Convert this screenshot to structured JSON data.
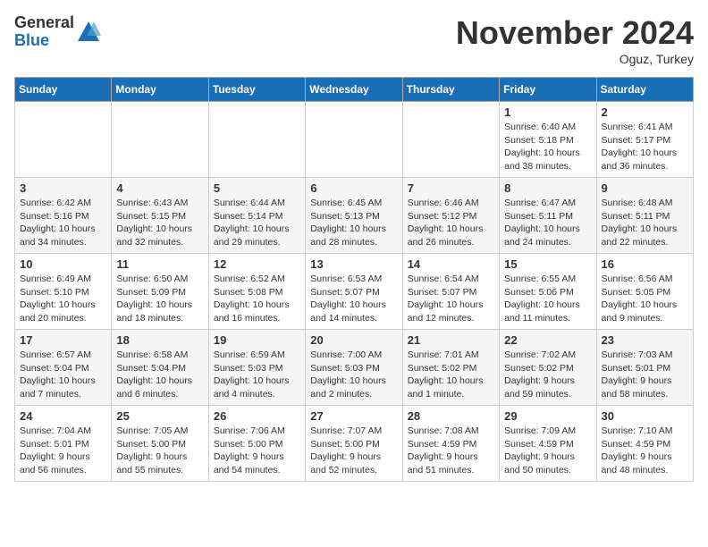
{
  "header": {
    "logo_general": "General",
    "logo_blue": "Blue",
    "month_title": "November 2024",
    "location": "Oguz, Turkey"
  },
  "weekdays": [
    "Sunday",
    "Monday",
    "Tuesday",
    "Wednesday",
    "Thursday",
    "Friday",
    "Saturday"
  ],
  "rows": [
    [
      {
        "day": "",
        "info": ""
      },
      {
        "day": "",
        "info": ""
      },
      {
        "day": "",
        "info": ""
      },
      {
        "day": "",
        "info": ""
      },
      {
        "day": "",
        "info": ""
      },
      {
        "day": "1",
        "info": "Sunrise: 6:40 AM\nSunset: 5:18 PM\nDaylight: 10 hours\nand 38 minutes."
      },
      {
        "day": "2",
        "info": "Sunrise: 6:41 AM\nSunset: 5:17 PM\nDaylight: 10 hours\nand 36 minutes."
      }
    ],
    [
      {
        "day": "3",
        "info": "Sunrise: 6:42 AM\nSunset: 5:16 PM\nDaylight: 10 hours\nand 34 minutes."
      },
      {
        "day": "4",
        "info": "Sunrise: 6:43 AM\nSunset: 5:15 PM\nDaylight: 10 hours\nand 32 minutes."
      },
      {
        "day": "5",
        "info": "Sunrise: 6:44 AM\nSunset: 5:14 PM\nDaylight: 10 hours\nand 29 minutes."
      },
      {
        "day": "6",
        "info": "Sunrise: 6:45 AM\nSunset: 5:13 PM\nDaylight: 10 hours\nand 28 minutes."
      },
      {
        "day": "7",
        "info": "Sunrise: 6:46 AM\nSunset: 5:12 PM\nDaylight: 10 hours\nand 26 minutes."
      },
      {
        "day": "8",
        "info": "Sunrise: 6:47 AM\nSunset: 5:11 PM\nDaylight: 10 hours\nand 24 minutes."
      },
      {
        "day": "9",
        "info": "Sunrise: 6:48 AM\nSunset: 5:11 PM\nDaylight: 10 hours\nand 22 minutes."
      }
    ],
    [
      {
        "day": "10",
        "info": "Sunrise: 6:49 AM\nSunset: 5:10 PM\nDaylight: 10 hours\nand 20 minutes."
      },
      {
        "day": "11",
        "info": "Sunrise: 6:50 AM\nSunset: 5:09 PM\nDaylight: 10 hours\nand 18 minutes."
      },
      {
        "day": "12",
        "info": "Sunrise: 6:52 AM\nSunset: 5:08 PM\nDaylight: 10 hours\nand 16 minutes."
      },
      {
        "day": "13",
        "info": "Sunrise: 6:53 AM\nSunset: 5:07 PM\nDaylight: 10 hours\nand 14 minutes."
      },
      {
        "day": "14",
        "info": "Sunrise: 6:54 AM\nSunset: 5:07 PM\nDaylight: 10 hours\nand 12 minutes."
      },
      {
        "day": "15",
        "info": "Sunrise: 6:55 AM\nSunset: 5:06 PM\nDaylight: 10 hours\nand 11 minutes."
      },
      {
        "day": "16",
        "info": "Sunrise: 6:56 AM\nSunset: 5:05 PM\nDaylight: 10 hours\nand 9 minutes."
      }
    ],
    [
      {
        "day": "17",
        "info": "Sunrise: 6:57 AM\nSunset: 5:04 PM\nDaylight: 10 hours\nand 7 minutes."
      },
      {
        "day": "18",
        "info": "Sunrise: 6:58 AM\nSunset: 5:04 PM\nDaylight: 10 hours\nand 6 minutes."
      },
      {
        "day": "19",
        "info": "Sunrise: 6:59 AM\nSunset: 5:03 PM\nDaylight: 10 hours\nand 4 minutes."
      },
      {
        "day": "20",
        "info": "Sunrise: 7:00 AM\nSunset: 5:03 PM\nDaylight: 10 hours\nand 2 minutes."
      },
      {
        "day": "21",
        "info": "Sunrise: 7:01 AM\nSunset: 5:02 PM\nDaylight: 10 hours\nand 1 minute."
      },
      {
        "day": "22",
        "info": "Sunrise: 7:02 AM\nSunset: 5:02 PM\nDaylight: 9 hours\nand 59 minutes."
      },
      {
        "day": "23",
        "info": "Sunrise: 7:03 AM\nSunset: 5:01 PM\nDaylight: 9 hours\nand 58 minutes."
      }
    ],
    [
      {
        "day": "24",
        "info": "Sunrise: 7:04 AM\nSunset: 5:01 PM\nDaylight: 9 hours\nand 56 minutes."
      },
      {
        "day": "25",
        "info": "Sunrise: 7:05 AM\nSunset: 5:00 PM\nDaylight: 9 hours\nand 55 minutes."
      },
      {
        "day": "26",
        "info": "Sunrise: 7:06 AM\nSunset: 5:00 PM\nDaylight: 9 hours\nand 54 minutes."
      },
      {
        "day": "27",
        "info": "Sunrise: 7:07 AM\nSunset: 5:00 PM\nDaylight: 9 hours\nand 52 minutes."
      },
      {
        "day": "28",
        "info": "Sunrise: 7:08 AM\nSunset: 4:59 PM\nDaylight: 9 hours\nand 51 minutes."
      },
      {
        "day": "29",
        "info": "Sunrise: 7:09 AM\nSunset: 4:59 PM\nDaylight: 9 hours\nand 50 minutes."
      },
      {
        "day": "30",
        "info": "Sunrise: 7:10 AM\nSunset: 4:59 PM\nDaylight: 9 hours\nand 48 minutes."
      }
    ]
  ]
}
